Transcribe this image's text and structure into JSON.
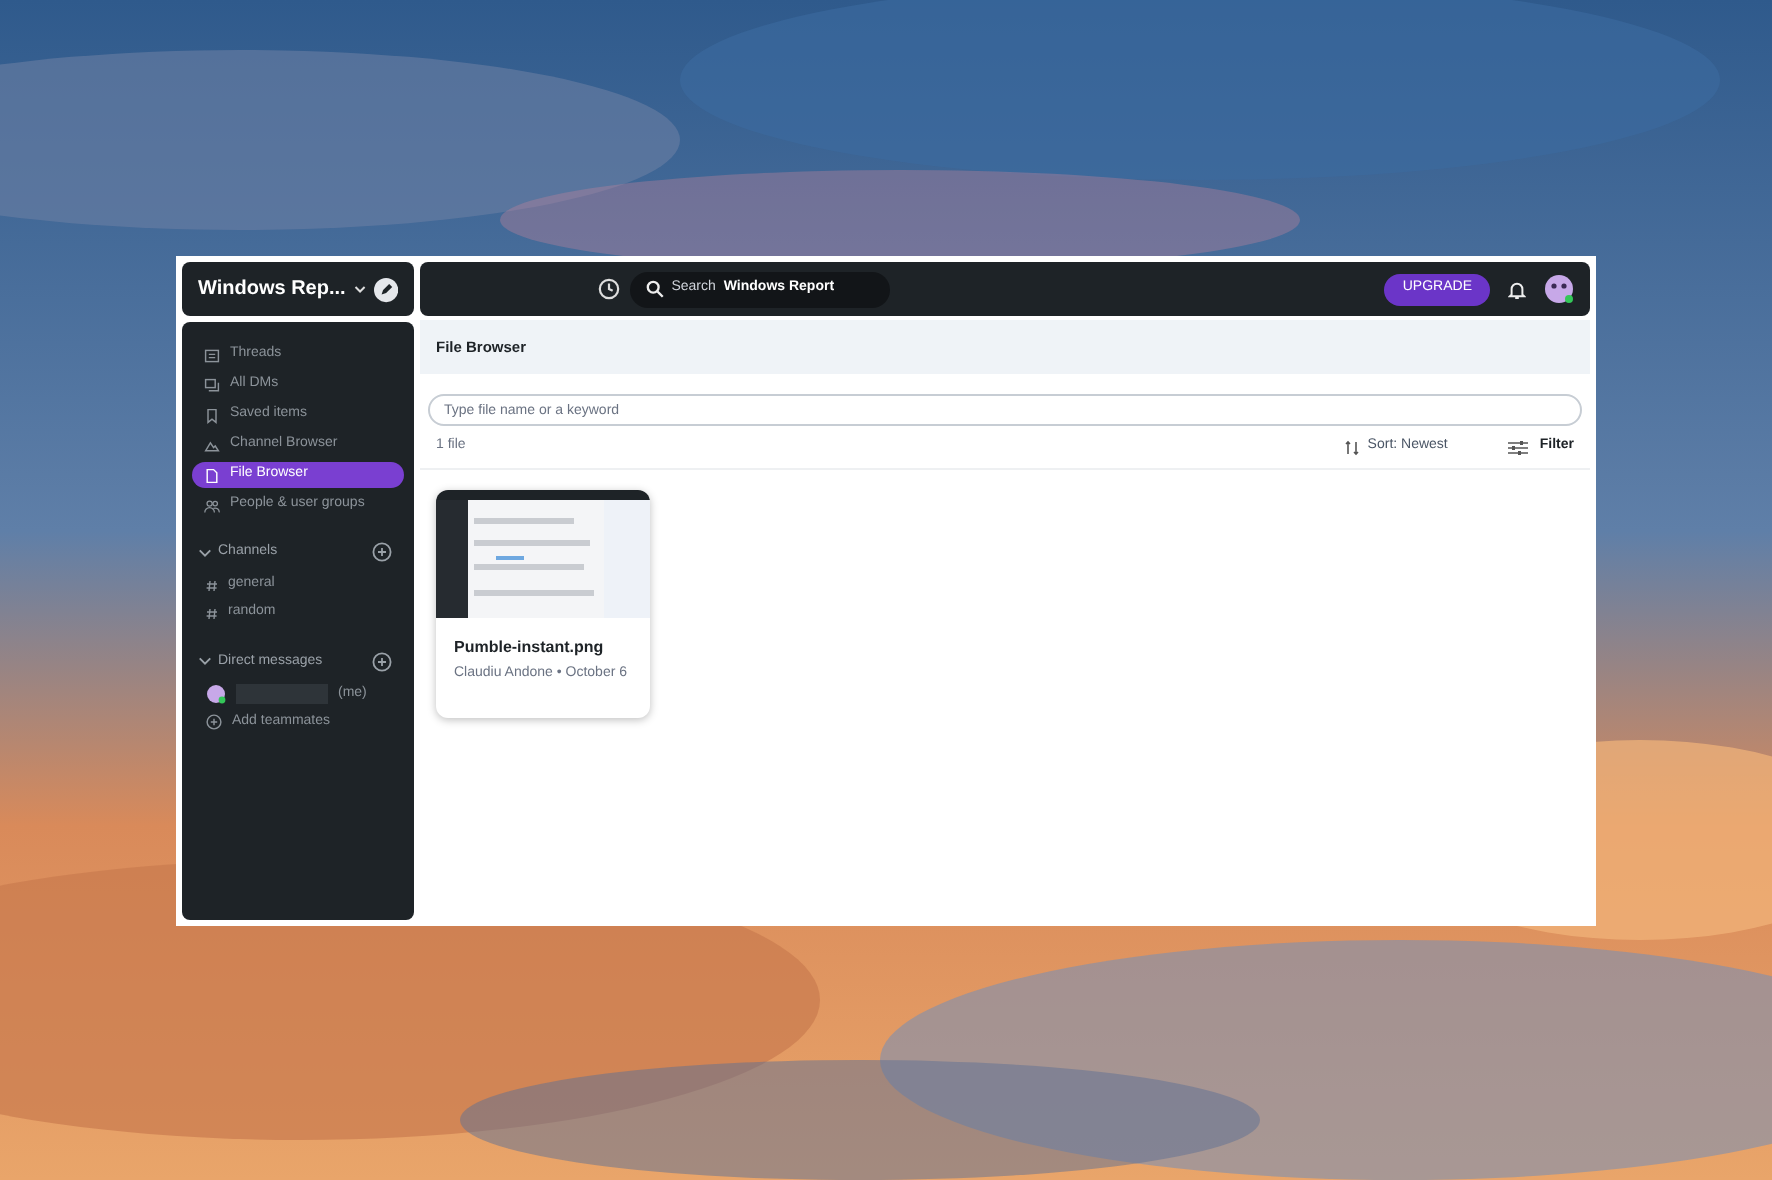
{
  "workspace": {
    "name": "Windows Rep..."
  },
  "nav": [
    {
      "label": "Threads",
      "kind": "threads",
      "selected": false
    },
    {
      "label": "All DMs",
      "kind": "dms",
      "selected": false
    },
    {
      "label": "Saved items",
      "kind": "saved",
      "selected": false
    },
    {
      "label": "Channel Browser",
      "kind": "channels",
      "selected": false
    },
    {
      "label": "File Browser",
      "kind": "files",
      "selected": true
    },
    {
      "label": "People & user groups",
      "kind": "people",
      "selected": false
    }
  ],
  "sections": [
    {
      "title": "Channels",
      "expanded": true,
      "items": [
        {
          "label": "general",
          "kind": "channel"
        },
        {
          "label": "random",
          "kind": "channel"
        }
      ]
    },
    {
      "title": "Direct messages",
      "expanded": true,
      "items": [
        {
          "label": "(me)",
          "kind": "self"
        },
        {
          "label": "Add teammates",
          "kind": "add"
        }
      ]
    }
  ],
  "topbar": {
    "search_label": "Search",
    "search_scope": "Windows Report",
    "upgrade": "UPGRADE"
  },
  "page": {
    "title": "File Browser",
    "search": {
      "placeholder": "Type file name or a keyword"
    },
    "count": "1 file",
    "sort": "Sort: Newest",
    "filter": "Filter"
  },
  "files": [
    {
      "name": "Pumble-instant.png",
      "meta": "Claudiu Andone • October 6"
    }
  ]
}
